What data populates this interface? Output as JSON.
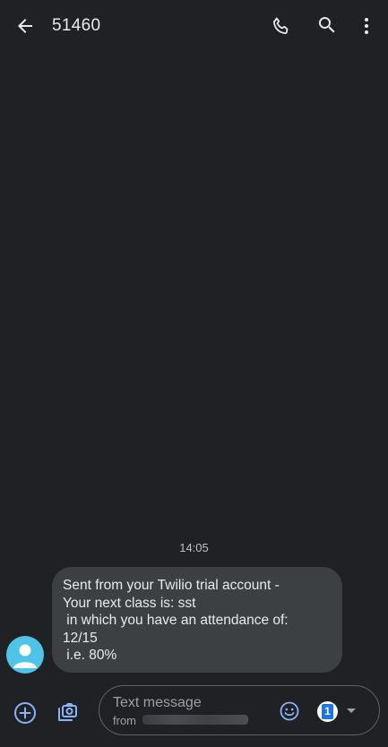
{
  "header": {
    "title": "51460"
  },
  "conversation": {
    "timestamp": "14:05",
    "message_lines": [
      "Sent from your Twilio trial account -",
      "Your next class is: sst",
      " in which you have an attendance of:",
      "12/15",
      " i.e. 80%"
    ]
  },
  "compose": {
    "placeholder": "Text message",
    "from_label": "from",
    "sim_number": "1"
  },
  "icons": {
    "back": "arrow-back-icon",
    "call": "phone-icon",
    "search": "search-icon",
    "more": "more-vert-icon",
    "add": "add-circle-icon",
    "gallery": "gallery-camera-icon",
    "emoji": "emoji-icon",
    "avatar": "person-icon",
    "sim_dropdown": "chevron-down-icon"
  },
  "colors": {
    "background": "#202124",
    "bubble": "#3c4043",
    "avatar": "#4fc3e8",
    "accent": "#8ab4f8",
    "sim_badge": "#1a73e8"
  }
}
